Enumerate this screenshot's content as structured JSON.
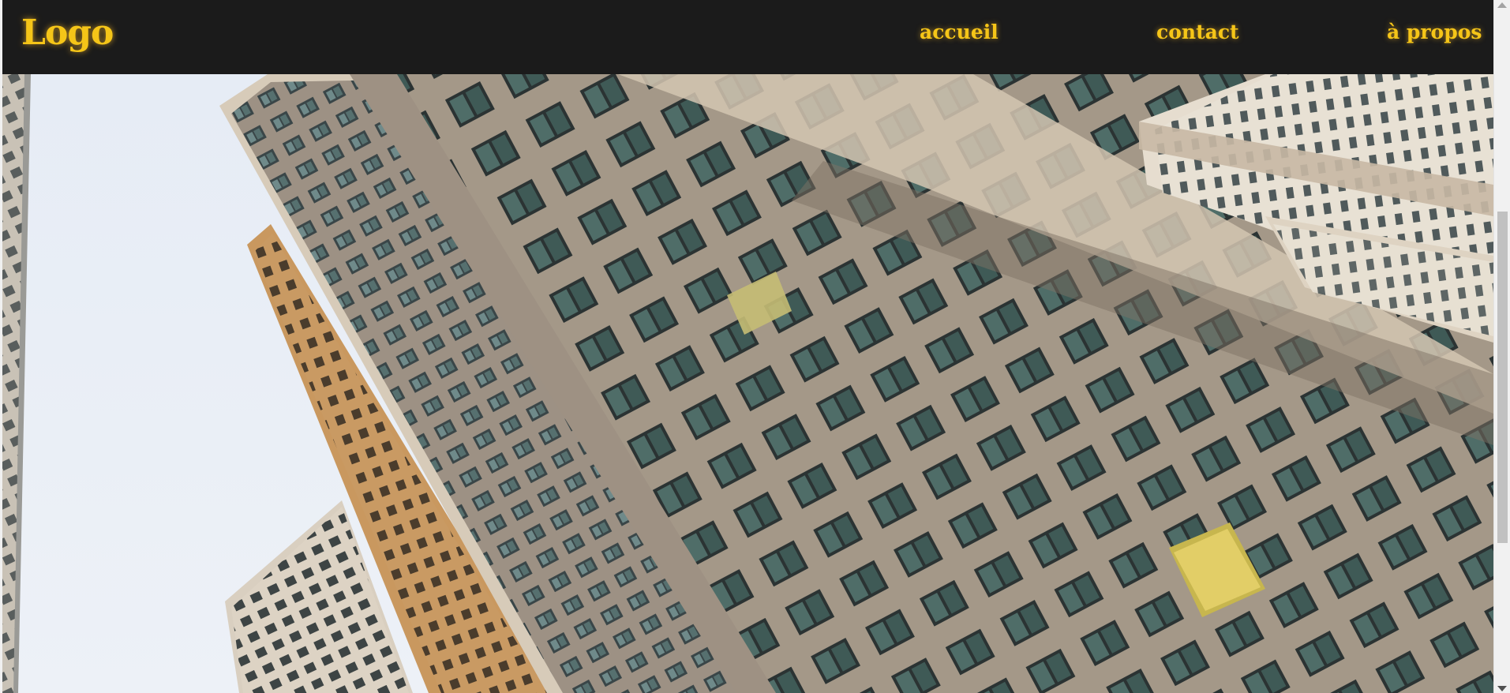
{
  "navbar": {
    "logo": "Logo",
    "links": [
      {
        "label": "accueil"
      },
      {
        "label": "contact"
      },
      {
        "label": "à propos"
      }
    ]
  },
  "hero": {
    "image": "tall-apartment-buildings-looking-up"
  },
  "colors": {
    "navbar_bg": "#1b1b1b",
    "accent": "#f5c518",
    "sky": "#e9eef6"
  }
}
